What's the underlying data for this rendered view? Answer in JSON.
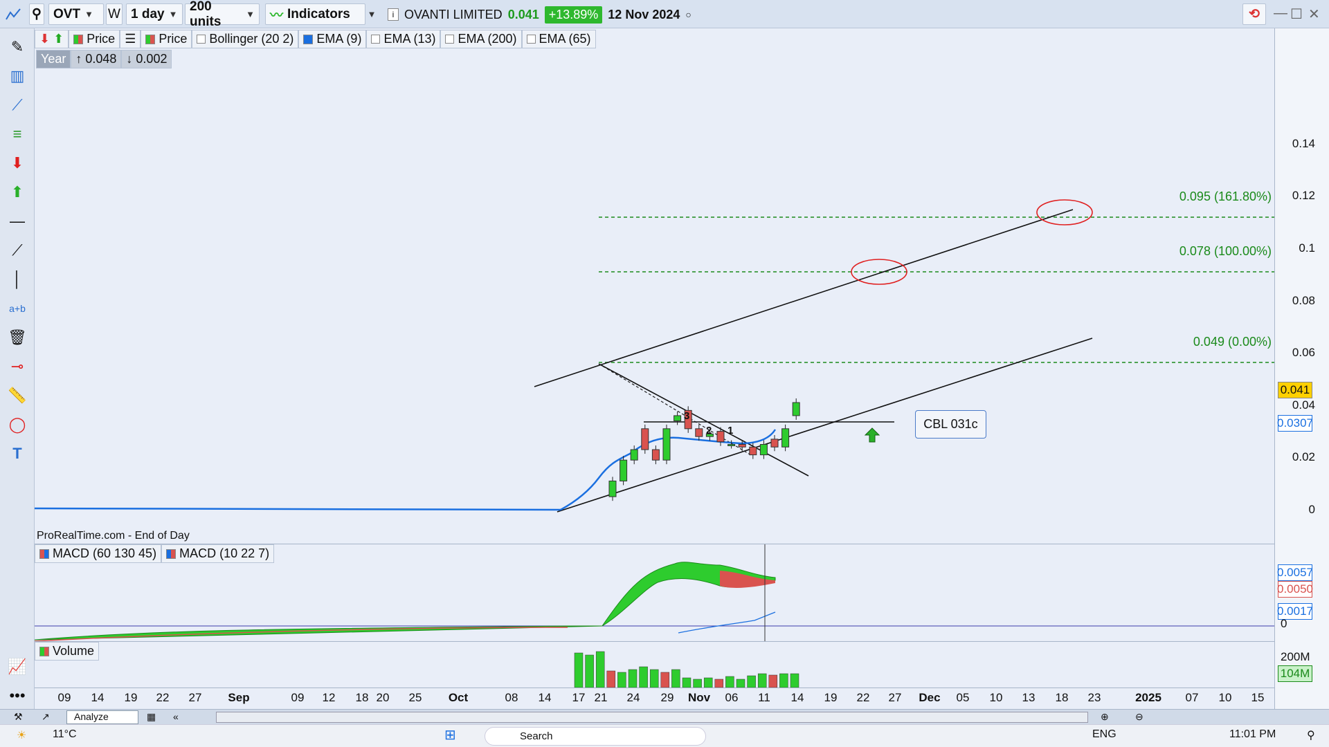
{
  "toolbar": {
    "symbol": "OVT",
    "w_label": "W",
    "period": "1 day",
    "units": "200 units",
    "indicators": "Indicators",
    "instrument_name": "OVANTI LIMITED",
    "last_price": "0.041",
    "change_pct": "+13.89%",
    "date": "12 Nov 2024"
  },
  "legend": {
    "price1": "Price",
    "price2": "Price",
    "bollinger": "Bollinger (20 2)",
    "ema9": "EMA (9)",
    "ema13": "EMA (13)",
    "ema200": "EMA (200)",
    "ema65": "EMA (65)",
    "year_label": "Year",
    "year_high": "0.048",
    "year_low": "0.002"
  },
  "source_note": "ProRealTime.com - End of Day",
  "macd_legend": {
    "macd1": "MACD (60 130 45)",
    "macd2": "MACD (10 22 7)"
  },
  "volume_legend": "Volume",
  "annotations": {
    "fib_0": "0.049 (0.00%)",
    "fib_100": "0.078 (100.00%)",
    "fib_161": "0.095 (161.80%)",
    "wave_3": "3",
    "wave_2": "2",
    "wave_1": "1",
    "cbl_box": "CBL 031c"
  },
  "price_axis": {
    "ticks": [
      "0.14",
      "0.12",
      "0.1",
      "0.08",
      "0.06",
      "0.04",
      "0.02",
      "0"
    ],
    "tag_last": "0.041",
    "tag_ema": "0.0307"
  },
  "macd_axis": {
    "tag1": "0.0057",
    "tag2": "0.0050",
    "tag3": "0.0017",
    "zero": "0"
  },
  "volume_axis": {
    "tick": "200M",
    "tag": "104M"
  },
  "x_axis": [
    "09",
    "14",
    "19",
    "22",
    "27",
    "Sep",
    "09",
    "12",
    "18",
    "20",
    "25",
    "Oct",
    "08",
    "14",
    "17",
    "21",
    "24",
    "29",
    "Nov",
    "06",
    "11",
    "14",
    "19",
    "22",
    "27",
    "Dec",
    "05",
    "10",
    "13",
    "18",
    "23",
    "2025",
    "07",
    "10",
    "15"
  ],
  "taskbar": {
    "temp": "11°C",
    "search": "Search",
    "lang": "ENG",
    "time": "11:01 PM",
    "tab": "Analyze"
  },
  "colors": {
    "up": "#2ecc2e",
    "down": "#d9534f",
    "ema": "#1a6fe0",
    "fib": "#1a8a1a",
    "circle": "#e02020",
    "accent": "#2eb82e"
  },
  "chart_data": {
    "type": "candlestick",
    "price_range": [
      0,
      0.15
    ],
    "candles": [
      {
        "date": "Oct 17",
        "open": 0.005,
        "close": 0.011
      },
      {
        "date": "Oct 18",
        "open": 0.011,
        "close": 0.019
      },
      {
        "date": "Oct 21",
        "open": 0.019,
        "close": 0.023
      },
      {
        "date": "Oct 22",
        "open": 0.031,
        "close": 0.023
      },
      {
        "date": "Oct 23",
        "open": 0.023,
        "close": 0.019
      },
      {
        "date": "Oct 24",
        "open": 0.019,
        "close": 0.031
      },
      {
        "date": "Oct 28",
        "open": 0.034,
        "close": 0.036
      },
      {
        "date": "Oct 29",
        "open": 0.038,
        "close": 0.031
      },
      {
        "date": "Oct 30",
        "open": 0.031,
        "close": 0.028
      },
      {
        "date": "Oct 31",
        "open": 0.028,
        "close": 0.029
      },
      {
        "date": "Nov 01",
        "open": 0.03,
        "close": 0.026
      },
      {
        "date": "Nov 04",
        "open": 0.025,
        "close": 0.025
      },
      {
        "date": "Nov 05",
        "open": 0.025,
        "close": 0.024
      },
      {
        "date": "Nov 06",
        "open": 0.024,
        "close": 0.021
      },
      {
        "date": "Nov 07",
        "open": 0.021,
        "close": 0.025
      },
      {
        "date": "Nov 08",
        "open": 0.027,
        "close": 0.024
      },
      {
        "date": "Nov 11",
        "open": 0.024,
        "close": 0.031
      },
      {
        "date": "Nov 12",
        "open": 0.036,
        "close": 0.041
      }
    ]
  }
}
